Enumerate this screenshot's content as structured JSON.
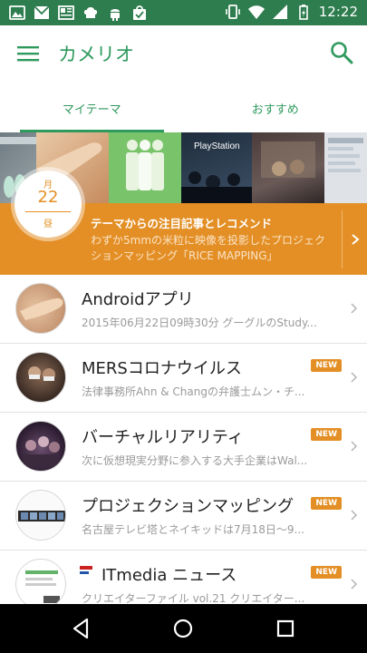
{
  "status_bar": {
    "time": "12:22",
    "left_icons": [
      "photo-icon",
      "mail-icon",
      "news-icon",
      "chef-hat-icon",
      "android-icon",
      "shopping-bag-icon"
    ],
    "right_icons": [
      "vibrate-icon",
      "wifi-icon",
      "signal-icon",
      "battery-icon"
    ]
  },
  "app_bar": {
    "title": "カメリオ",
    "menu_icon": "hamburger-menu-icon",
    "search_icon": "search-icon"
  },
  "tabs": [
    {
      "label": "マイテーマ",
      "active": true
    },
    {
      "label": "おすすめ",
      "active": false
    }
  ],
  "banner": {
    "date": {
      "month": "月",
      "day": "22",
      "time_of_day": "昼"
    },
    "heading": "テーマからの注目記事とレコメンド",
    "description": "わずか5mmの米粒に映像を投影したプロジェクションマッピング「RICE MAPPING」",
    "tile_label": "PlayStation"
  },
  "items": [
    {
      "title": "Androidアプリ",
      "subtitle": "2015年06月22日09時30分 グーグルのStudy...",
      "new": false
    },
    {
      "title": "MERSコロナウイルス",
      "subtitle": "法律事務所Ahn & Changの弁護士ムン・チ...",
      "new": true
    },
    {
      "title": "バーチャルリアリティ",
      "subtitle": "次に仮想現実分野に参入する大手企業はWal...",
      "new": true
    },
    {
      "title": "プロジェクションマッピング",
      "subtitle": "名古屋テレビ塔とネイキッドは7月18日～9...",
      "new": true
    },
    {
      "title": "ITmedia ニュース",
      "subtitle": "クリエイターファイル vol.21 クリエイター...",
      "new": true
    }
  ],
  "new_badge_label": "NEW",
  "itmedia_logo_text": "ITmedia ニュース",
  "colors": {
    "status_bar": "#2e7d4f",
    "accent_green": "#2f9a5e",
    "accent_orange": "#e38f25"
  },
  "nav_bar": {
    "back": "back-icon",
    "home": "home-icon",
    "recents": "recents-icon"
  }
}
